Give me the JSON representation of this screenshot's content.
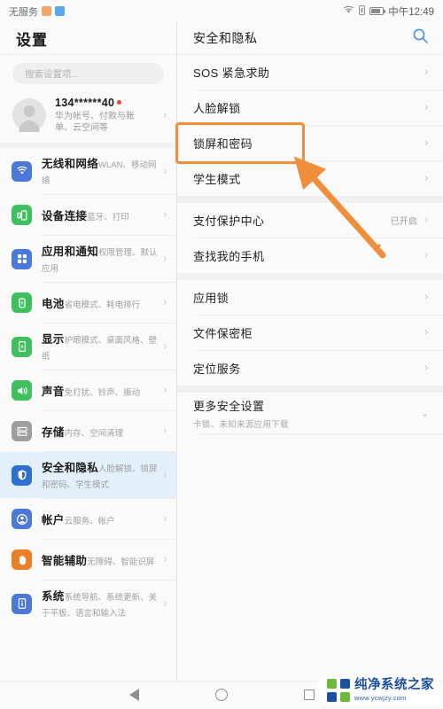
{
  "statusbar": {
    "carrier": "无服务",
    "badges": [
      "app-badge-orange",
      "app-badge-blue"
    ],
    "wifi_icon": "wifi-icon",
    "sim_icon": "sim-card-icon",
    "battery_icon": "battery-icon",
    "time": "中午12:49"
  },
  "sidebar": {
    "title": "设置",
    "search": {
      "placeholder": "搜索设置项..."
    },
    "account": {
      "name": "134******40",
      "subtitle": "华为帐号、付款与账单、云空间等",
      "badge": "new-dot",
      "avatar": "avatar-icon",
      "chevron": "chevron-right-icon"
    },
    "items": [
      {
        "label": "无线和网络",
        "sub": "WLAN、移动网络",
        "icon": "wifi-icon",
        "color": "#4a79d9",
        "selected": false
      },
      {
        "label": "设备连接",
        "sub": "蓝牙、打印",
        "icon": "device-connect-icon",
        "color": "#3fc05f",
        "selected": false
      },
      {
        "label": "应用和通知",
        "sub": "权限管理、默认应用",
        "icon": "apps-grid-icon",
        "color": "#4a79d9",
        "selected": false
      },
      {
        "label": "电池",
        "sub": "省电模式、耗电排行",
        "icon": "battery-icon",
        "color": "#3fc05f",
        "selected": false
      },
      {
        "label": "显示",
        "sub": "护眼模式、桌面风格、壁纸",
        "icon": "display-icon",
        "color": "#3fc05f",
        "selected": false
      },
      {
        "label": "声音",
        "sub": "免打扰、铃声、振动",
        "icon": "sound-icon",
        "color": "#3fc05f",
        "selected": false
      },
      {
        "label": "存储",
        "sub": "内存、空间清理",
        "icon": "storage-icon",
        "color": "#9e9e9e",
        "selected": false
      },
      {
        "label": "安全和隐私",
        "sub": "人脸解锁、锁屏和密码、学生模式",
        "icon": "shield-icon",
        "color": "#2f6fd0",
        "selected": true
      },
      {
        "label": "帐户",
        "sub": "云服务、帐户",
        "icon": "account-icon",
        "color": "#4a79d9",
        "selected": false
      },
      {
        "label": "智能辅助",
        "sub": "无障碍、智能识屏",
        "icon": "hand-icon",
        "color": "#ee7e25",
        "selected": false
      },
      {
        "label": "系统",
        "sub": "系统导航、系统更新、关于平板、语言和输入法",
        "icon": "system-info-icon",
        "color": "#4a79d9",
        "selected": false
      }
    ]
  },
  "detail": {
    "title": "安全和隐私",
    "search_icon": "search-icon",
    "groups": [
      {
        "items": [
          {
            "label": "SOS 紧急求助",
            "value": "",
            "chevron": "chevron-right-icon",
            "highlighted": false
          },
          {
            "label": "人脸解锁",
            "value": "",
            "chevron": "chevron-right-icon",
            "highlighted": false
          },
          {
            "label": "锁屏和密码",
            "value": "",
            "chevron": "chevron-right-icon",
            "highlighted": true
          },
          {
            "label": "学生模式",
            "value": "",
            "chevron": "chevron-right-icon",
            "highlighted": false
          }
        ]
      },
      {
        "items": [
          {
            "label": "支付保护中心",
            "value": "已开启",
            "chevron": "chevron-right-icon",
            "highlighted": false
          },
          {
            "label": "查找我的手机",
            "value": "",
            "chevron": "chevron-right-icon",
            "highlighted": false
          }
        ]
      },
      {
        "items": [
          {
            "label": "应用锁",
            "value": "",
            "chevron": "chevron-right-icon",
            "highlighted": false
          },
          {
            "label": "文件保密柜",
            "value": "",
            "chevron": "chevron-right-icon",
            "highlighted": false
          },
          {
            "label": "定位服务",
            "value": "",
            "chevron": "chevron-right-icon",
            "highlighted": false
          }
        ]
      },
      {
        "items": [
          {
            "label": "更多安全设置",
            "sub": "卡锁、未知来源应用下载",
            "value": "",
            "chevron": "chevron-down-icon",
            "highlighted": false
          }
        ]
      }
    ]
  },
  "annotation": {
    "highlight_color": "#ef8f3c",
    "highlight_target": "锁屏和密码",
    "arrow": "pointer-arrow"
  },
  "navbar": {
    "back": "back-triangle-icon",
    "home": "home-circle-icon",
    "recents": "recents-square-icon"
  },
  "watermark": {
    "name": "纯净系统之家",
    "url": "www.ycwjzy.com",
    "logo": "four-square-logo"
  }
}
